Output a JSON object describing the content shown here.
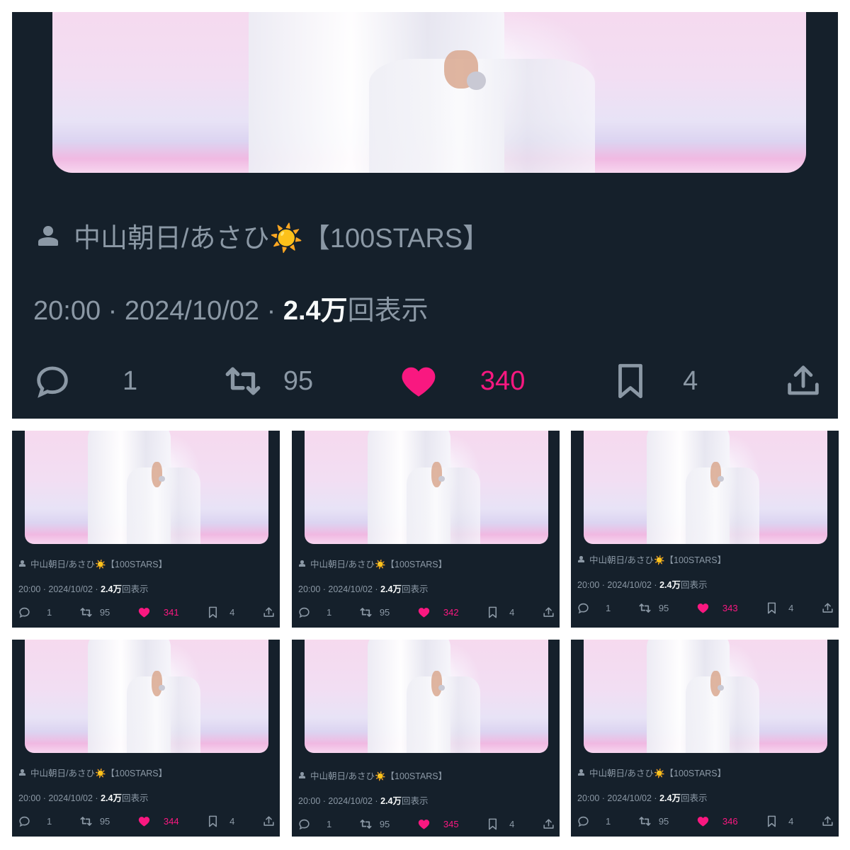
{
  "tweets": [
    {
      "author": "中山朝日/あさひ☀️【100STARS】",
      "time": "20:00",
      "date": "2024/10/02",
      "views_strong": "2.4万",
      "views_suffix": "回表示",
      "replies": "1",
      "retweets": "95",
      "likes": "340",
      "bookmarks": "4"
    },
    {
      "author": "中山朝日/あさひ☀️【100STARS】",
      "time": "20:00",
      "date": "2024/10/02",
      "views_strong": "2.4万",
      "views_suffix": "回表示",
      "replies": "1",
      "retweets": "95",
      "likes": "341",
      "bookmarks": "4"
    },
    {
      "author": "中山朝日/あさひ☀️【100STARS】",
      "time": "20:00",
      "date": "2024/10/02",
      "views_strong": "2.4万",
      "views_suffix": "回表示",
      "replies": "1",
      "retweets": "95",
      "likes": "342",
      "bookmarks": "4"
    },
    {
      "author": "中山朝日/あさひ☀️【100STARS】",
      "time": "20:00",
      "date": "2024/10/02",
      "views_strong": "2.4万",
      "views_suffix": "回表示",
      "replies": "1",
      "retweets": "95",
      "likes": "343",
      "bookmarks": "4"
    },
    {
      "author": "中山朝日/あさひ☀️【100STARS】",
      "time": "20:00",
      "date": "2024/10/02",
      "views_strong": "2.4万",
      "views_suffix": "回表示",
      "replies": "1",
      "retweets": "95",
      "likes": "344",
      "bookmarks": "4"
    },
    {
      "author": "中山朝日/あさひ☀️【100STARS】",
      "time": "20:00",
      "date": "2024/10/02",
      "views_strong": "2.4万",
      "views_suffix": "回表示",
      "replies": "1",
      "retweets": "95",
      "likes": "345",
      "bookmarks": "4"
    },
    {
      "author": "中山朝日/あさひ☀️【100STARS】",
      "time": "20:00",
      "date": "2024/10/02",
      "views_strong": "2.4万",
      "views_suffix": "回表示",
      "replies": "1",
      "retweets": "95",
      "likes": "346",
      "bookmarks": "4"
    }
  ],
  "icons": {
    "author": "person-icon",
    "reply": "reply-bubble-icon",
    "retweet": "retweet-icon",
    "like": "heart-icon",
    "bookmark": "bookmark-icon",
    "share": "share-icon"
  },
  "colors": {
    "background": "#15202b",
    "text_muted": "#8b98a5",
    "text_strong": "#f7f9f9",
    "like": "#f91880",
    "page": "#ffffff"
  }
}
